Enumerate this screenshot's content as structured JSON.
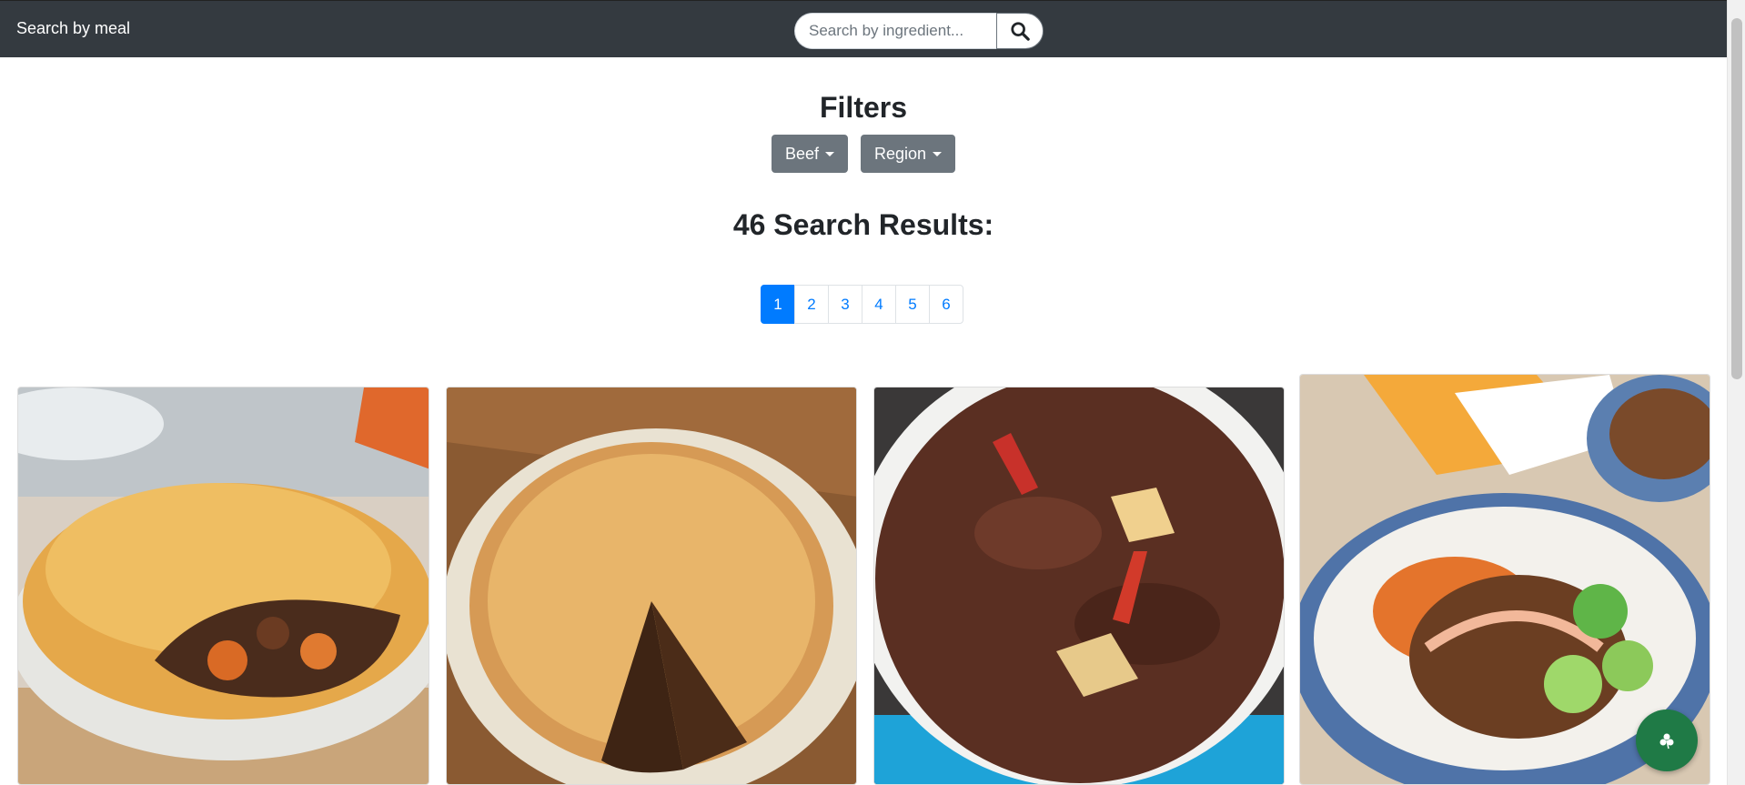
{
  "navbar": {
    "brand": "Search by meal",
    "search_placeholder": "Search by ingredient..."
  },
  "filters": {
    "title": "Filters",
    "category_label": "Beef",
    "region_label": "Region"
  },
  "results": {
    "title": "46 Search Results:"
  },
  "pagination": {
    "pages": [
      "1",
      "2",
      "3",
      "4",
      "5",
      "6"
    ],
    "active": "1"
  },
  "colors": {
    "navbar": "#343a40",
    "accent": "#007bff",
    "filter_button": "#6c757d",
    "fab": "#1f7a46"
  },
  "icons": {
    "search": "search-icon",
    "fab": "clover-icon"
  }
}
